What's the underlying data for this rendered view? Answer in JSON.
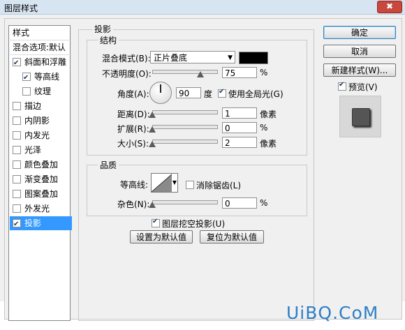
{
  "window": {
    "title": "图层样式",
    "close_label": "✖"
  },
  "style_list": {
    "header": "样式",
    "blend_options": "混合选项:默认",
    "items": [
      {
        "label": "斜面和浮雕",
        "checked": true
      },
      {
        "label": "等高线",
        "checked": true
      },
      {
        "label": "纹理",
        "checked": false
      },
      {
        "label": "描边",
        "checked": false
      },
      {
        "label": "内阴影",
        "checked": false
      },
      {
        "label": "内发光",
        "checked": false
      },
      {
        "label": "光泽",
        "checked": false
      },
      {
        "label": "颜色叠加",
        "checked": false
      },
      {
        "label": "渐变叠加",
        "checked": false
      },
      {
        "label": "图案叠加",
        "checked": false
      },
      {
        "label": "外发光",
        "checked": false
      },
      {
        "label": "投影",
        "checked": true
      }
    ]
  },
  "drop_shadow": {
    "group_title": "投影",
    "structure": {
      "title": "结构",
      "blend_mode_label": "混合模式(B):",
      "blend_mode_value": "正片叠底",
      "shadow_color": "#000000",
      "opacity_label": "不透明度(O):",
      "opacity_value": "75",
      "opacity_unit": "%",
      "opacity_level": 0.75,
      "angle_label": "角度(A):",
      "angle_value": "90",
      "angle_unit": "度",
      "global_light_label": "使用全局光(G)",
      "global_light_checked": true,
      "distance_label": "距离(D):",
      "distance_value": "1",
      "distance_unit": "像素",
      "spread_label": "扩展(R):",
      "spread_value": "0",
      "spread_unit": "%",
      "size_label": "大小(S):",
      "size_value": "2",
      "size_unit": "像素"
    },
    "quality": {
      "title": "品质",
      "contour_label": "等高线:",
      "anti_alias_label": "消除锯齿(L)",
      "anti_alias_checked": false,
      "noise_label": "杂色(N):",
      "noise_value": "0",
      "noise_unit": "%"
    },
    "knockout_label": "图层挖空投影(U)",
    "knockout_checked": true,
    "set_default_label": "设置为默认值",
    "reset_default_label": "复位为默认值"
  },
  "buttons": {
    "ok": "确定",
    "cancel": "取消",
    "new_style": "新建样式(W)...",
    "preview_label": "预览(V)",
    "preview_checked": true
  },
  "watermark": "UiBQ.CoM"
}
